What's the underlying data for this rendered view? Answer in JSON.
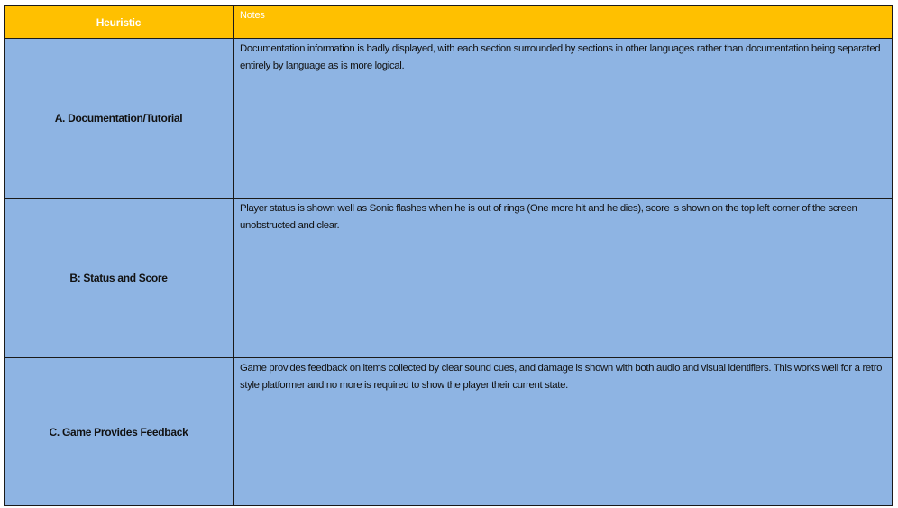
{
  "table": {
    "headers": {
      "heuristic": "Heuristic",
      "notes": "Notes"
    },
    "rows": [
      {
        "heuristic": "A. Documentation/Tutorial",
        "notes": "Documentation information is badly displayed, with each section surrounded by sections in other languages rather than documentation being separated entirely by language as is more logical."
      },
      {
        "heuristic": "B: Status and Score",
        "notes": " Player status is shown well as Sonic flashes when he is out of rings (One more hit and he dies), score is shown on the top left corner of the screen unobstructed and clear."
      },
      {
        "heuristic": "C. Game Provides Feedback",
        "notes": "Game provides feedback on items collected by clear sound cues, and damage is shown with both audio and visual identifiers. This works well for a retro style platformer and no more is required to show the player their current state."
      }
    ]
  },
  "colors": {
    "header_background": "#ffc000",
    "header_text": "#ffffff",
    "row_background": "#8eb4e3",
    "border": "#1a1a1a"
  }
}
